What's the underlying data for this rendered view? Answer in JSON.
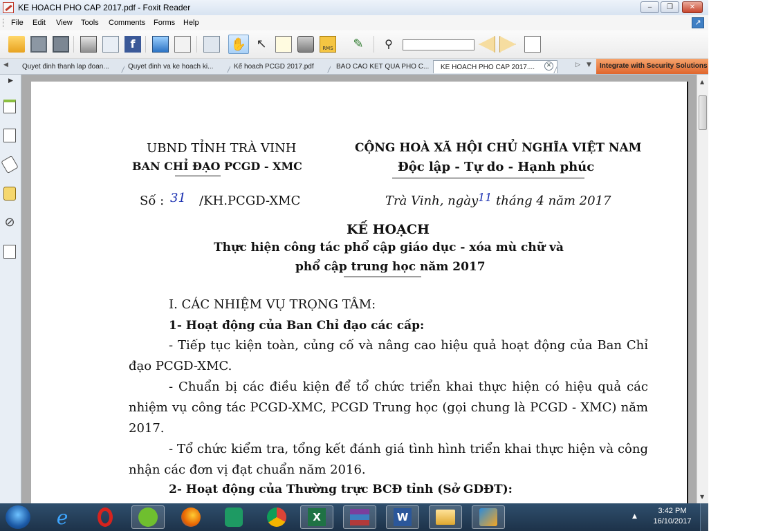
{
  "window": {
    "title": "KE HOACH PHO CAP 2017.pdf - Foxit Reader",
    "controls": {
      "minimize": "‒",
      "maximize": "❐",
      "close": "✕"
    }
  },
  "menu": [
    "File",
    "Edit",
    "View",
    "Tools",
    "Comments",
    "Forms",
    "Help"
  ],
  "toolbar_icons": [
    "open-folder-icon",
    "save-icon",
    "save-all-icon",
    "print-icon",
    "email-icon",
    "facebook-icon",
    "monitor-icon",
    "scan-icon",
    "layers-icon",
    "hand-tool-icon",
    "select-arrow-icon",
    "text-select-icon",
    "snapshot-camera-icon",
    "rms-lock-icon",
    "signature-pen-icon",
    "find-binoculars-icon",
    "previous-result-icon",
    "next-result-icon",
    "export-page-icon"
  ],
  "rms_label": "RMS",
  "tabs": [
    {
      "label": "Quyet đinh thanh lap đoan..."
    },
    {
      "label": "Quyet đinh va ke hoach ki..."
    },
    {
      "label": "Kế hoach PCGD 2017.pdf"
    },
    {
      "label": "BAO CAO KET QUA PHO C..."
    },
    {
      "label": "KE HOACH PHO CAP 2017...."
    }
  ],
  "promo_text": "Integrate with Security Solutions",
  "document": {
    "org_left_line1": "UBND TỈNH TRÀ VINH",
    "org_left_line2": "BAN CHỈ ĐẠO PCGD - XMC",
    "org_right_line1": "CỘNG HOÀ XÃ HỘI CHỦ NGHĨA VIỆT NAM",
    "org_right_line2": "Độc lập - Tự do - Hạnh phúc",
    "number_prefix": "Số :",
    "number_handwritten": "31",
    "number_suffix": "/KH.PCGD-XMC",
    "date_prefix": "Trà Vinh, ngày",
    "date_day_handwritten": "11",
    "date_suffix": "tháng  4  năm  2017",
    "doc_title": "KẾ HOẠCH",
    "doc_subtitle1": "Thực hiện công tác phổ cập giáo dục - xóa mù chữ và",
    "doc_subtitle2": "phổ cập trung học năm 2017",
    "section1": "I. CÁC NHIỆM VỤ TRỌNG TÂM:",
    "sub1": "1- Hoạt động của Ban Chỉ đạo các cấp:",
    "p1": "- Tiếp tục kiện toàn, củng cố và nâng cao hiệu quả hoạt động của Ban Chỉ đạo PCGD-XMC.",
    "p2": "- Chuẩn bị các điều kiện để tổ chức triển khai thực hiện có hiệu quả các nhiệm vụ công tác PCGD-XMC, PCGD Trung học (gọi chung là PCGD - XMC) năm 2017.",
    "p3": "- Tổ chức kiểm tra, tổng kết đánh giá tình hình triển khai thực hiện và công nhận các đơn vị đạt chuẩn năm 2016.",
    "sub2": "2- Hoạt động của Thường trực BCĐ tỉnh (Sở GDĐT):"
  },
  "taskbar": {
    "apps": [
      "start-orb-icon",
      "internet-explorer-icon",
      "opera-icon",
      "coc-coc-icon",
      "firefox-icon",
      "android-icon",
      "chrome-icon",
      "excel-icon",
      "winrar-icon",
      "word-icon",
      "file-explorer-icon",
      "foxit-reader-icon"
    ],
    "time": "3:42 PM",
    "date": "16/10/2017"
  },
  "colors": {
    "accent_orange": "#e0662d",
    "handwriting_blue": "#1a2fb0",
    "taskbar": "#1d3249"
  }
}
